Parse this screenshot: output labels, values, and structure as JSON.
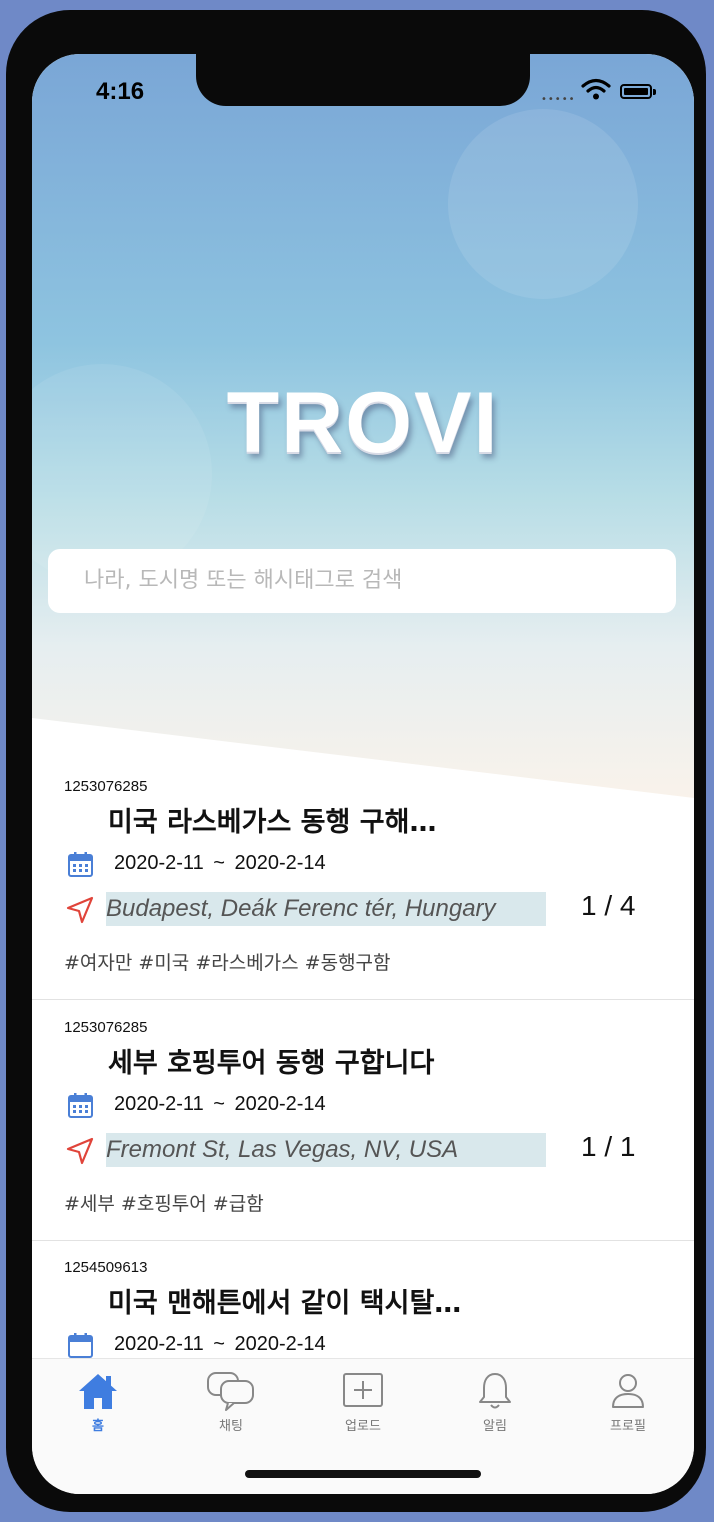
{
  "status_bar": {
    "time": "4:16"
  },
  "app": {
    "logo": "TROVI"
  },
  "search": {
    "placeholder": "나라, 도시명 또는 해시태그로 검색"
  },
  "posts": [
    {
      "id": "1253076285",
      "title": "미국 라스베가스 동행 구해…",
      "dates": "2020-2-11  ~  2020-2-14",
      "location": "Budapest, Deák Ferenc tér, Hungary",
      "count": "1 / 4",
      "tags": "#여자만 #미국 #라스베가스 #동행구함"
    },
    {
      "id": "1253076285",
      "title": "세부 호핑투어 동행 구합니다",
      "dates": "2020-2-11  ~  2020-2-14",
      "location": "Fremont St, Las Vegas, NV, USA",
      "count": "1 / 1",
      "tags": "#세부 #호핑투어 #급함"
    },
    {
      "id": "1254509613",
      "title": "미국 맨해튼에서 같이 택시탈…",
      "dates": "2020-2-11  ~  2020-2-14"
    }
  ],
  "tabs": [
    {
      "label": "홈",
      "icon": "home-icon",
      "active": true
    },
    {
      "label": "채팅",
      "icon": "chat-icon"
    },
    {
      "label": "업로드",
      "icon": "upload-icon"
    },
    {
      "label": "알림",
      "icon": "bell-icon"
    },
    {
      "label": "프로필",
      "icon": "profile-icon"
    }
  ],
  "colors": {
    "accent": "#3f7de0",
    "pin": "#e0443a",
    "calendar": "#4a7fd6",
    "location_highlight": "#d9e8ec"
  }
}
